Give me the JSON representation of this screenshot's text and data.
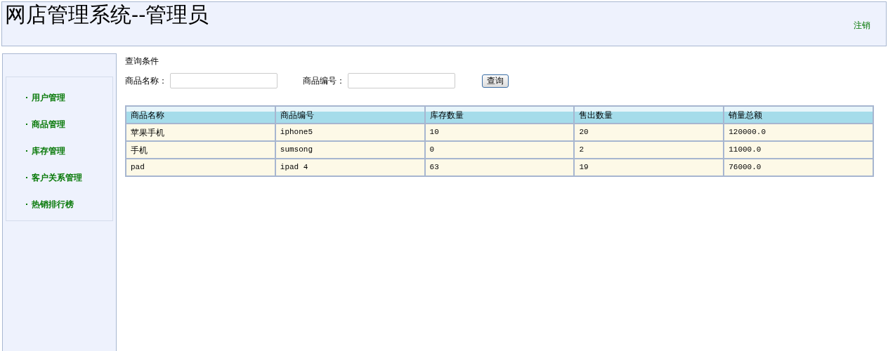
{
  "header": {
    "title": "网店管理系统--管理员",
    "logout_link": "注销"
  },
  "sidebar": {
    "items": [
      {
        "label": "用户管理"
      },
      {
        "label": "商品管理"
      },
      {
        "label": "库存管理"
      },
      {
        "label": "客户关系管理"
      },
      {
        "label": "热销排行榜"
      }
    ]
  },
  "search": {
    "title": "查询条件",
    "fields": [
      {
        "label": "商品名称："
      },
      {
        "label": "商品编号："
      }
    ],
    "button": "查询"
  },
  "table": {
    "columns": [
      "商品名称",
      "商品编号",
      "库存数量",
      "售出数量",
      "销量总额"
    ],
    "rows": [
      [
        "苹果手机",
        "iphone5",
        "10",
        "20",
        "120000.0"
      ],
      [
        "手机",
        "sumsong",
        "0",
        "2",
        "11000.0"
      ],
      [
        "pad",
        "ipad 4",
        "63",
        "19",
        "76000.0"
      ]
    ]
  }
}
